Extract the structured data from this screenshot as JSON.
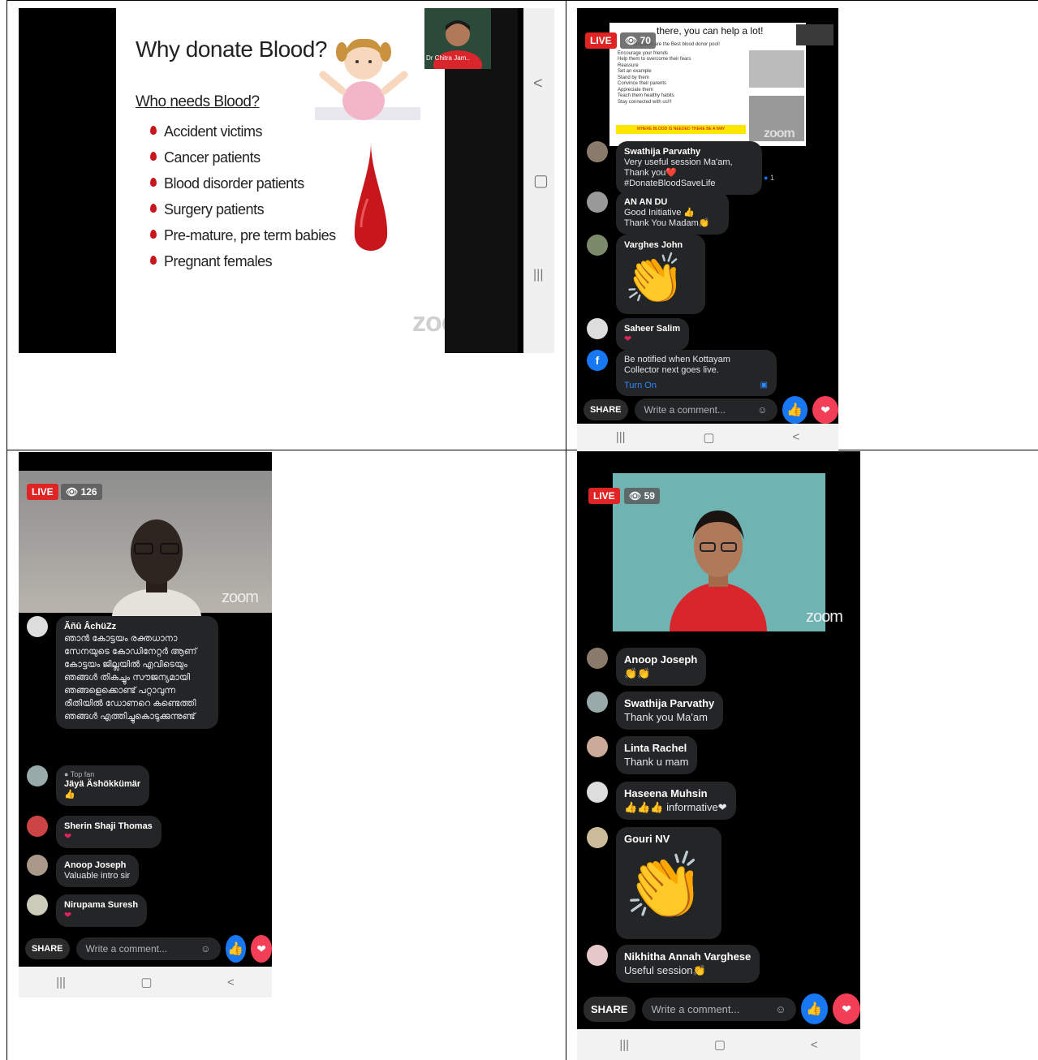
{
  "cell1": {
    "slide_title": "Why donate Blood?",
    "slide_subtitle": "Who needs Blood?",
    "slide_items": [
      "Accident victims",
      "Cancer patients",
      "Blood disorder patients",
      "Surgery patients",
      "Pre-mature, pre term babies",
      "Pregnant females"
    ],
    "presenter_label": "Dr Chitra Jam..",
    "zoom_watermark": "zoom",
    "side_nav": [
      "<",
      "▢",
      "|||"
    ]
  },
  "cell2": {
    "live": "LIVE",
    "views": "70",
    "slide_title": "there, you can  help a lot!",
    "slide_lines": [
      "Youngsters are the Best blood donor pool!",
      "Encourage your friends",
      "Help them to overcome their fears",
      "Reassure",
      "Set an example",
      "Stand by them",
      "Convince their parents",
      "Appreciate them",
      "Teach them healthy habits",
      "Stay connected with us!!!"
    ],
    "slide_banner": "WHERE BLOOD IS NEEDED THERE BE A WAY",
    "zoom_watermark": "zoom",
    "comments": [
      {
        "name": "Swathija Parvathy",
        "text": "Very useful session Ma'am, Thank you❤️ #DonateBloodSaveLife",
        "reaction": "1"
      },
      {
        "name": "AN AN DU",
        "text": "Good Initiative 👍 Thank You Madam👏"
      },
      {
        "name": "Varghes John",
        "text": "👏"
      },
      {
        "name": "Saheer Salim",
        "text": "❤"
      }
    ],
    "notify_text": "Be notified when Kottayam Collector next goes live.",
    "turn_on": "Turn On",
    "share": "SHARE",
    "comment_placeholder": "Write a comment...",
    "nav": [
      "|||",
      "▢",
      "<"
    ]
  },
  "cell3": {
    "live": "LIVE",
    "views": "126",
    "zoom_watermark": "zoom",
    "comments": [
      {
        "name": "Ãñû ÂchüZz",
        "text": "ഞാൻ കോട്ടയം രക്തധാനാ സേനയുടെ കോഡിനേറ്റർ ആണ് കോട്ടയം ജില്ലയിൽ എവിടെയും ഞങ്ങൾ തികച്ചും സൗജന്യമായി ഞങ്ങളെക്കൊണ്ട് പറ്റാവുന്ന രീതിയിൽ ഡോണറെ കണ്ടെത്തി ഞങ്ങൾ എത്തിച്ചുകൊടുക്കുന്നുണ്ട്"
      },
      {
        "badge": "Top fan",
        "name": "Jäyä Äshökkümär",
        "text": "👍"
      },
      {
        "name": "Sherin Shaji Thomas",
        "text": "❤"
      },
      {
        "name": "Anoop Joseph",
        "text": "Valuable intro sir"
      },
      {
        "name": "Nirupama Suresh",
        "text": "❤"
      }
    ],
    "share": "SHARE",
    "comment_placeholder": "Write a comment...",
    "nav": [
      "|||",
      "▢",
      "<"
    ]
  },
  "cell4": {
    "live": "LIVE",
    "views": "59",
    "zoom_watermark": "zoom",
    "comments": [
      {
        "name": "Anoop Joseph",
        "text": "👏👏"
      },
      {
        "name": "Swathija Parvathy",
        "text": "Thank you Ma'am"
      },
      {
        "name": "Linta Rachel",
        "text": "Thank u mam"
      },
      {
        "name": "Haseena Muhsin",
        "text": "👍👍👍 informative❤"
      },
      {
        "name": "Gouri NV",
        "text": "👏"
      },
      {
        "name": "Nikhitha Annah Varghese",
        "text": "Useful session👏"
      }
    ],
    "share": "SHARE",
    "comment_placeholder": "Write a comment...",
    "nav": [
      "|||",
      "▢",
      "<"
    ]
  }
}
